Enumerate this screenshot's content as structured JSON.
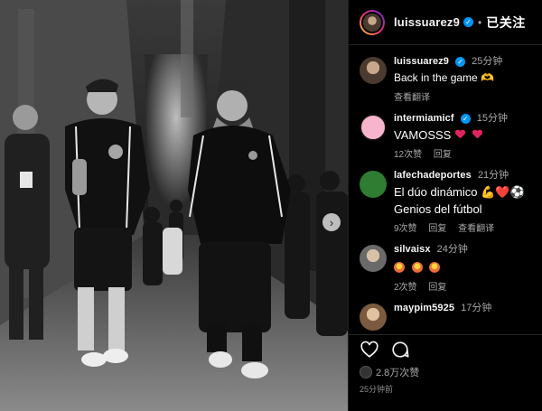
{
  "post": {
    "username": "luissuarez9",
    "follow_state": "已关注",
    "dot": "•",
    "caption_comment": {
      "user": "luissuarez9",
      "time": "25分钟",
      "text": "Back in the game 🫶",
      "meta": [
        "查看翻译"
      ]
    },
    "comments": [
      {
        "user": "intermiamicf",
        "verified": true,
        "time": "15分钟",
        "text": "VAMOSSS",
        "emoji": [
          "heart",
          "heart"
        ],
        "meta": [
          "12次赞",
          "回复"
        ]
      },
      {
        "user": "lafechadeportes",
        "verified": false,
        "time": "21分钟",
        "text": "El dúo dinámico 💪❤️⚽",
        "text2": "Genios del fútbol",
        "meta": [
          "9次赞",
          "回复",
          "查看翻译"
        ]
      },
      {
        "user": "silvaisx",
        "verified": false,
        "time": "24分钟",
        "text": "",
        "emoji": [
          "fire",
          "fire",
          "fire"
        ],
        "meta": [
          "2次赞",
          "回复"
        ]
      },
      {
        "user": "maypim5925",
        "verified": false,
        "time": "17分钟",
        "text": "",
        "meta": []
      }
    ],
    "likes": "2.8万次赞",
    "posted_ago": "25分钟前"
  },
  "icons": {
    "verified": "verified-badge-icon",
    "heart": "heart-outline-icon",
    "comment": "comment-bubble-icon",
    "next": "chevron-right-icon"
  },
  "colors": {
    "background": "#000000",
    "verified_blue": "#0095f6",
    "heart_red": "#e0245e",
    "muted_text": "#a8a8a8"
  }
}
